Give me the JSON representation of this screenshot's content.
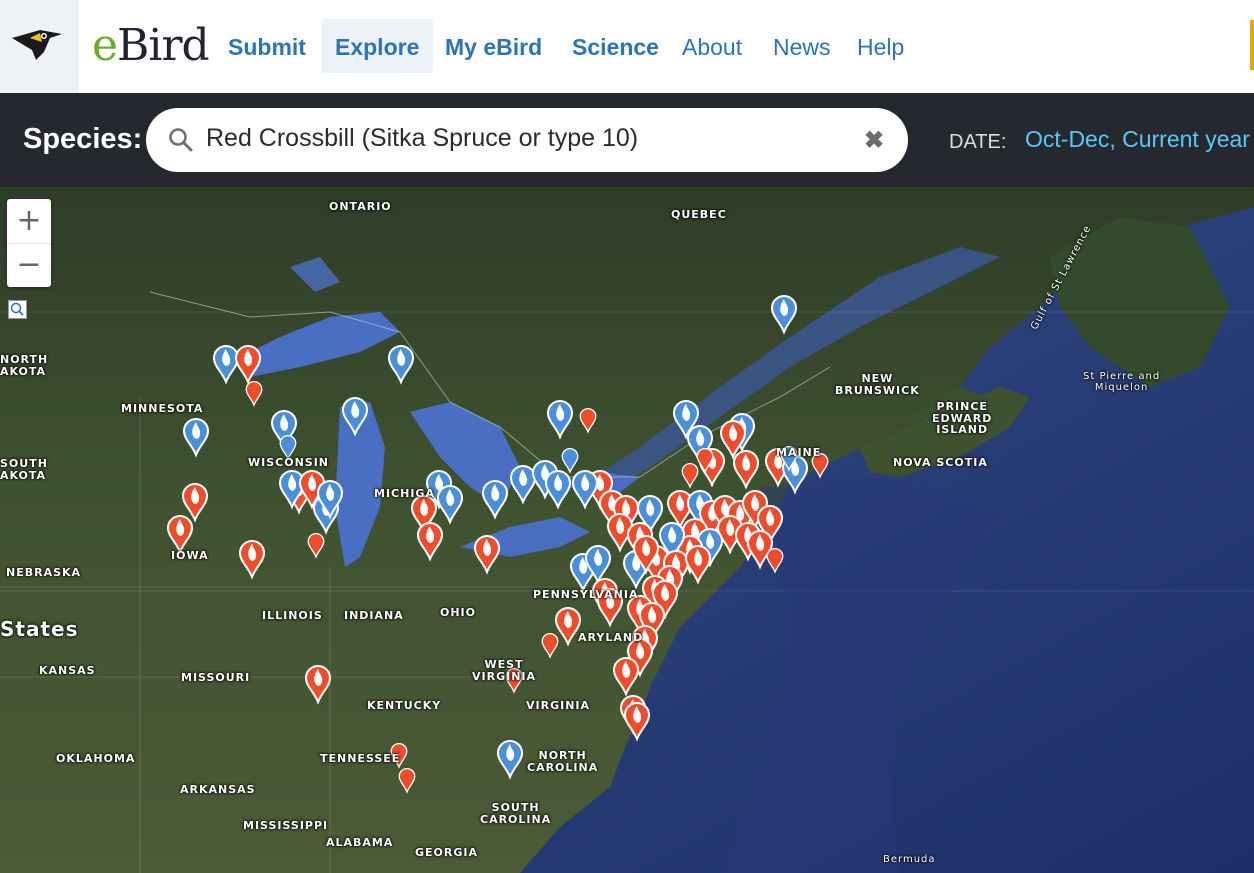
{
  "brand": {
    "logo_prefix": "e",
    "logo_rest": "Bird"
  },
  "nav": {
    "submit": "Submit",
    "explore": "Explore",
    "my_ebird": "My eBird",
    "science": "Science",
    "about": "About",
    "news": "News",
    "help": "Help"
  },
  "filter": {
    "species_label": "Species:",
    "species_value": "Red Crossbill (Sitka Spruce or type 10)",
    "date_label": "DATE:",
    "date_value": "Oct-Dec,  Current year"
  },
  "map": {
    "zoom_in": "+",
    "zoom_out": "−",
    "labels": {
      "ontario": "ONTARIO",
      "quebec": "QUEBEC",
      "gulf": "Gulf of St Lawrence",
      "north_dakota": "NORTH\nAKOTA",
      "minnesota": "MINNESOTA",
      "south_dakota": "SOUTH\nAKOTA",
      "wisconsin": "WISCONSIN",
      "michigan": "MICHIGA",
      "iowa": "IOWA",
      "nebraska": "NEBRASKA",
      "states": "States",
      "illinois": "ILLINOIS",
      "indiana": "INDIANA",
      "ohio": "OHIO",
      "pennsylvania": "PENNSYLVANIA",
      "maryland": "ARYLAND",
      "kansas": "KANSAS",
      "missouri": "MISSOURI",
      "west_virginia": "WEST\nVIRGINIA",
      "kentucky": "KENTUCKY",
      "virginia": "VIRGINIA",
      "oklahoma": "OKLAHOMA",
      "tennessee": "TENNESSEE",
      "north_carolina": "NORTH\nCAROLINA",
      "arkansas": "ARKANSAS",
      "mississippi": "MISSISSIPPI",
      "alabama": "ALABAMA",
      "georgia": "GEORGIA",
      "south_carolina": "SOUTH\nCAROLINA",
      "new_brunswick": "NEW\nBRUNSWICK",
      "pei": "PRINCE\nEDWARD\nISLAND",
      "nova_scotia": "NOVA SCOTIA",
      "maine": "MAINE",
      "st_pierre": "St Pierre and\nMiquelon",
      "bermuda": "Bermuda"
    },
    "marker_colors": {
      "recent": "#ee4d2d",
      "older": "#4a8fd8"
    }
  }
}
